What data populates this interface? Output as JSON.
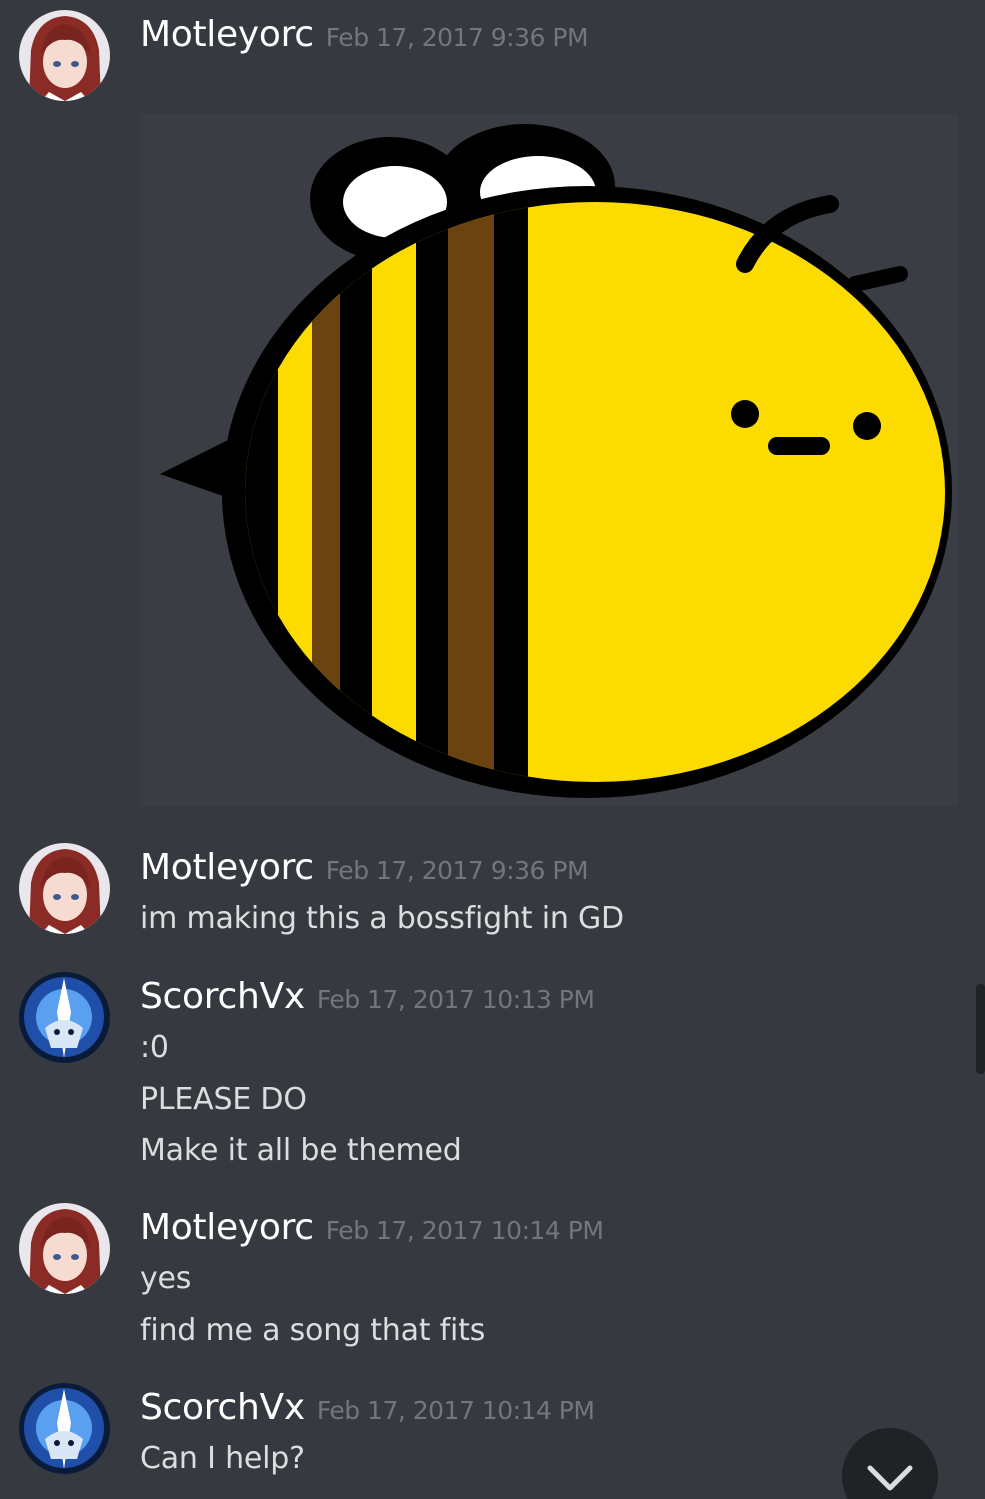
{
  "colors": {
    "background": "#36393f",
    "author": "#ffffff",
    "timestamp": "#72767d",
    "message_text": "#dcddde",
    "bee_yellow": "#fcdc00",
    "bee_brown": "#6b4311"
  },
  "messages": [
    {
      "author": "Motleyorc",
      "avatar_icon": "anime-girl-avatar-icon",
      "timestamp": "Feb 17, 2017 9:36 PM",
      "attachment": {
        "type": "image",
        "icon": "bee-drawing-icon"
      },
      "lines": []
    },
    {
      "author": "Motleyorc",
      "avatar_icon": "anime-girl-avatar-icon",
      "timestamp": "Feb 17, 2017 9:36 PM",
      "lines": [
        "im making this a bossfight in GD"
      ]
    },
    {
      "author": "ScorchVx",
      "avatar_icon": "blue-knight-avatar-icon",
      "timestamp": "Feb 17, 2017 10:13 PM",
      "lines": [
        ":0",
        "PLEASE DO",
        "Make it all be themed"
      ]
    },
    {
      "author": "Motleyorc",
      "avatar_icon": "anime-girl-avatar-icon",
      "timestamp": "Feb 17, 2017 10:14 PM",
      "lines": [
        "yes",
        "find me a song that fits"
      ]
    },
    {
      "author": "ScorchVx",
      "avatar_icon": "blue-knight-avatar-icon",
      "timestamp": "Feb 17, 2017 10:14 PM",
      "lines": [
        "Can I help?"
      ]
    }
  ],
  "jump_button_icon": "chevron-down-icon"
}
